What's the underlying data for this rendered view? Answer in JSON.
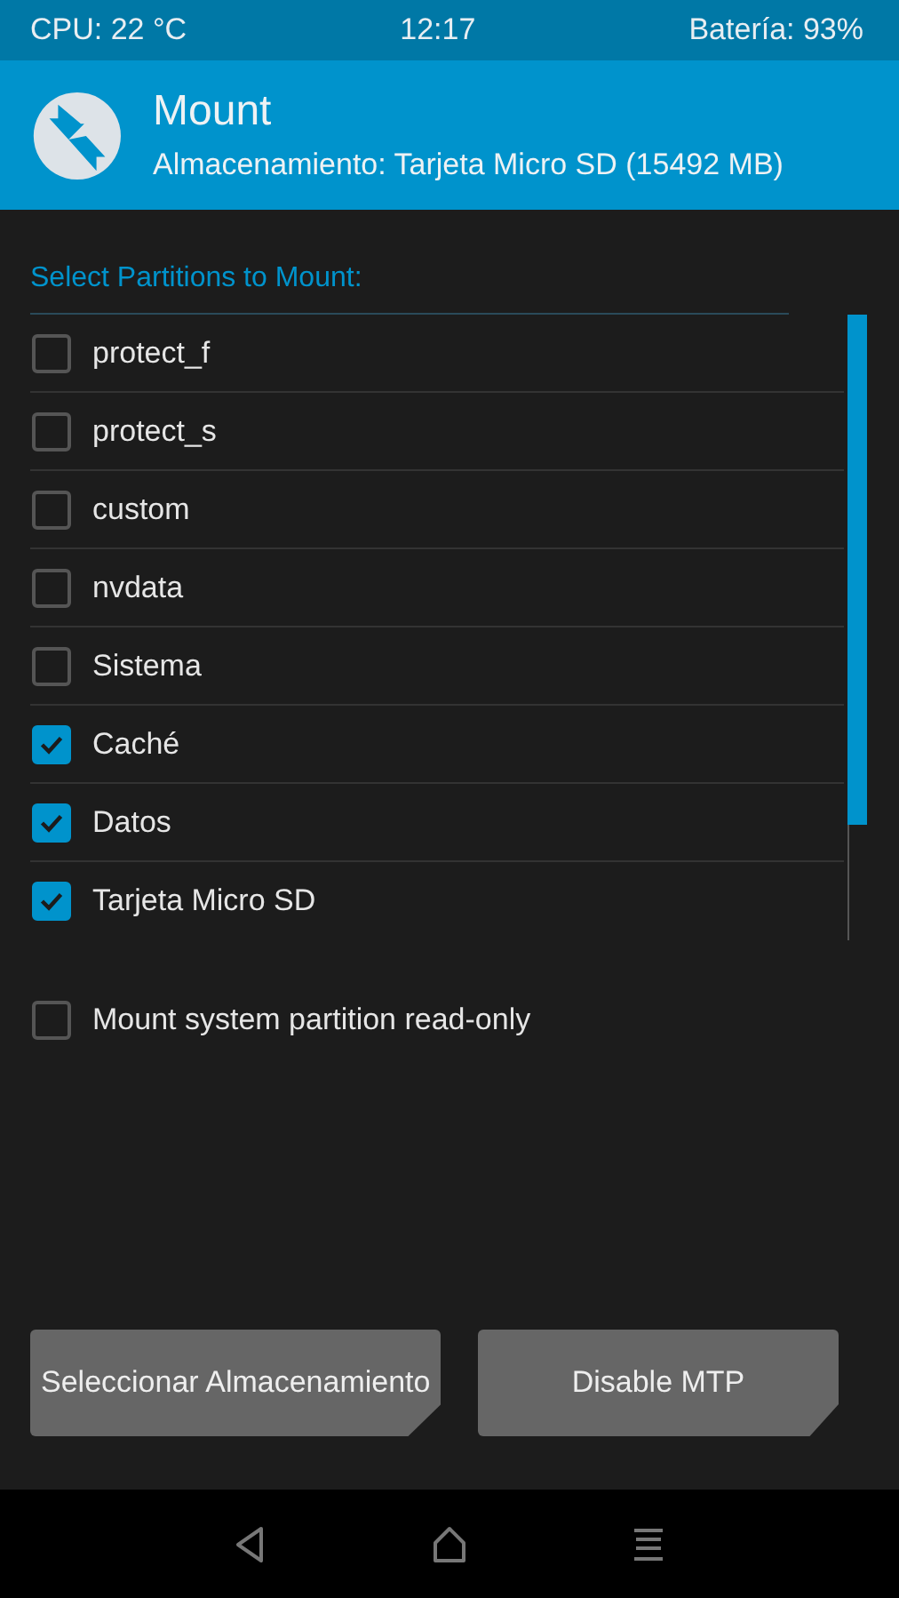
{
  "status_bar": {
    "cpu": "CPU: 22 °C",
    "time": "12:17",
    "battery": "Batería: 93%"
  },
  "header": {
    "title": "Mount",
    "subtitle": "Almacenamiento: Tarjeta Micro SD (15492 MB)"
  },
  "list_title": "Select Partitions to Mount:",
  "partitions": [
    {
      "label": "protect_f",
      "checked": false
    },
    {
      "label": "protect_s",
      "checked": false
    },
    {
      "label": "custom",
      "checked": false
    },
    {
      "label": "nvdata",
      "checked": false
    },
    {
      "label": "Sistema",
      "checked": false
    },
    {
      "label": "Caché",
      "checked": true
    },
    {
      "label": "Datos",
      "checked": true
    },
    {
      "label": "Tarjeta Micro SD",
      "checked": true
    }
  ],
  "options": [
    {
      "label": "Mount system partition read-only",
      "checked": false
    }
  ],
  "buttons": [
    "Seleccionar Almacenamiento",
    "Disable MTP"
  ]
}
